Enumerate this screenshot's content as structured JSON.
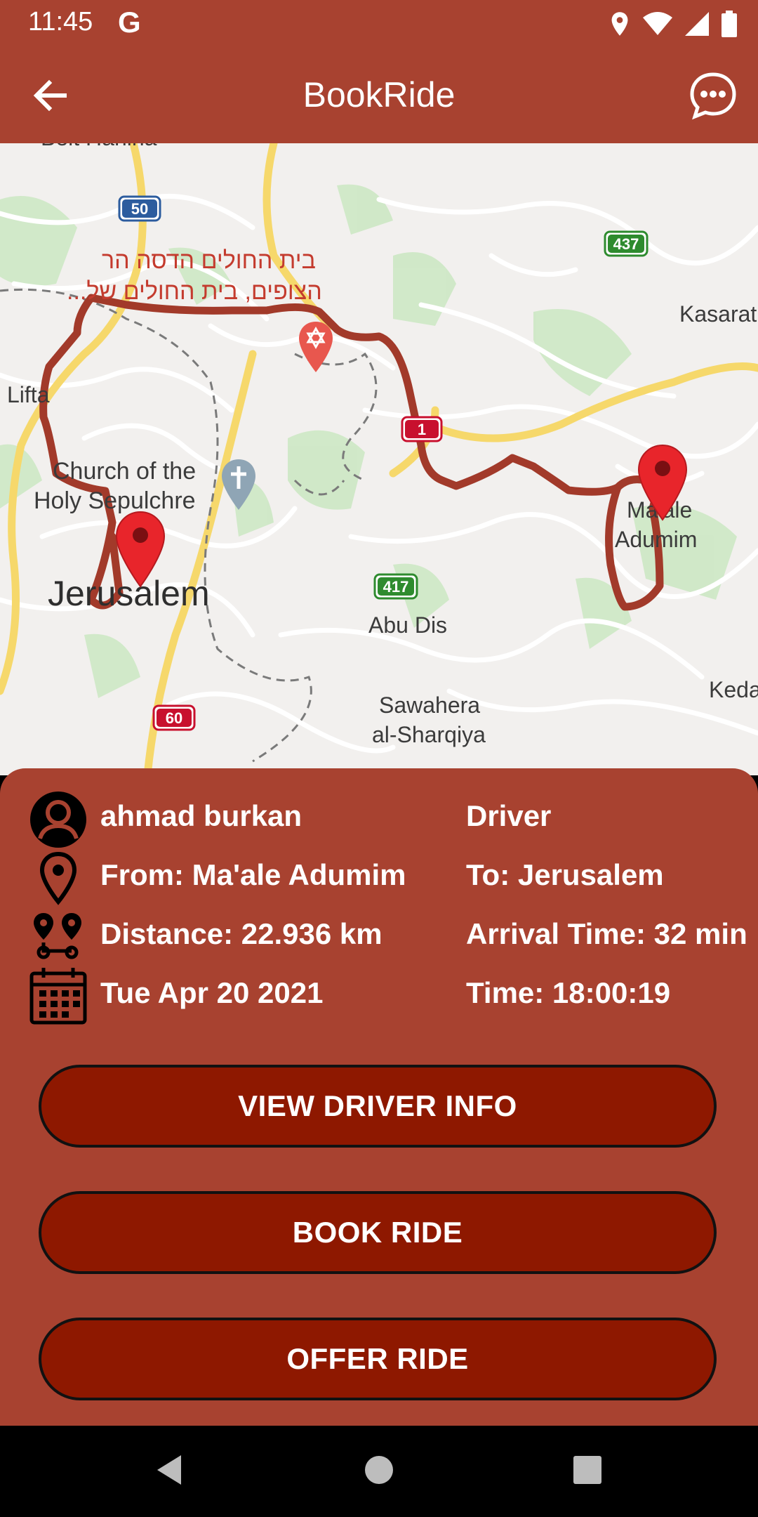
{
  "status_bar": {
    "time": "11:45",
    "g_label": "G"
  },
  "app_bar": {
    "title": "BookRide",
    "back_icon": "arrow-left-icon",
    "chat_icon": "chat-bubble-icon"
  },
  "map": {
    "labels": {
      "beit_hanina": "Beit Hanina",
      "hospital_line1": "בית החולים הדסה הר",
      "hospital_line2": "הצופים, בית החולים של...",
      "kasarat": "Kasarat",
      "lifta": "Lifta",
      "church_line1": "Church of the",
      "church_line2": "Holy Sepulchre",
      "jerusalem": "Jerusalem",
      "maale_line1": "Ma'ale",
      "maale_line2": "Adumim",
      "abu_dis": "Abu Dis",
      "sawahera_line1": "Sawahera",
      "sawahera_line2": "al-Sharqiya",
      "keda": "Keda"
    },
    "route_shields": {
      "r50": "50",
      "r437": "437",
      "r1": "1",
      "r417": "417",
      "r60": "60"
    },
    "route_color": "#A23A2A"
  },
  "ride": {
    "name": "ahmad burkan",
    "role": "Driver",
    "from": "From: Ma'ale Adumim",
    "to": "To: Jerusalem",
    "distance": "Distance: 22.936 km",
    "arrival": "Arrival Time: 32 min",
    "date": "Tue Apr 20 2021",
    "time": "Time: 18:00:19"
  },
  "buttons": {
    "view_driver": "VIEW DRIVER INFO",
    "book": "BOOK RIDE",
    "offer": "OFFER RIDE"
  },
  "colors": {
    "primary": "#A84230",
    "button": "#8E1800"
  }
}
